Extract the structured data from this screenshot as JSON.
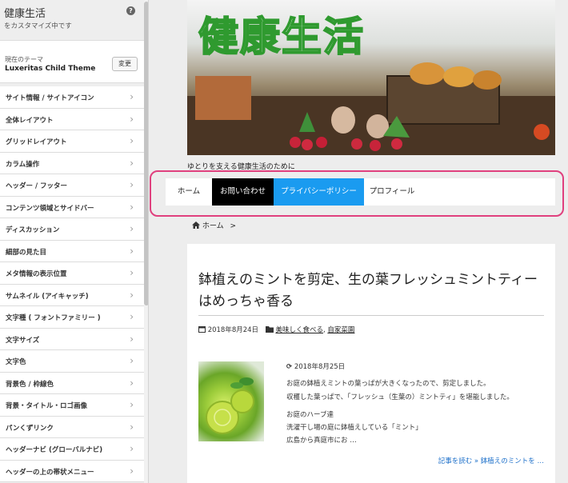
{
  "sidebar": {
    "title": "健康生活",
    "subtitle": "をカスタマイズ中です",
    "help_icon": "?",
    "theme_label": "現在のテーマ",
    "theme_name": "Luxeritas Child Theme",
    "change_label": "変更",
    "items": [
      {
        "label": "サイト情報 / サイトアイコン"
      },
      {
        "label": "全体レイアウト"
      },
      {
        "label": "グリッドレイアウト"
      },
      {
        "label": "カラム操作"
      },
      {
        "label": "ヘッダー / フッター"
      },
      {
        "label": "コンテンツ領域とサイドバー"
      },
      {
        "label": "ディスカッション"
      },
      {
        "label": "細部の見た目"
      },
      {
        "label": "メタ情報の表示位置"
      },
      {
        "label": "サムネイル (アイキャッチ)"
      },
      {
        "label": "文字種 ( フォントファミリー )"
      },
      {
        "label": "文字サイズ"
      },
      {
        "label": "文字色"
      },
      {
        "label": "背景色 / 枠線色"
      },
      {
        "label": "背景・タイトル・ロゴ画像"
      },
      {
        "label": "パンくずリンク"
      },
      {
        "label": "ヘッダーナビ (グローバルナビ)"
      },
      {
        "label": "ヘッダーの上の帯状メニュー"
      }
    ],
    "chevron": "›"
  },
  "preview": {
    "site_title": "健康生活",
    "tagline": "ゆとりを支える健康生活のために",
    "nav": [
      {
        "label": "ホーム",
        "bg": "#ffffff",
        "color": "#222222"
      },
      {
        "label": "お問い合わせ",
        "bg": "#000000",
        "color": "#ffffff"
      },
      {
        "label": "プライバシーポリシー",
        "bg": "#1a9bf0",
        "color": "#ffffff"
      },
      {
        "label": "プロフィール",
        "bg": "#ffffff",
        "color": "#222222"
      }
    ],
    "highlight_color": "#e0407e",
    "breadcrumb": {
      "home": "ホーム",
      "sep": ">"
    },
    "article": {
      "title": "鉢植えのミントを剪定、生の葉フレッシュミントティーはめっちゃ香る",
      "date": "2018年8月24日",
      "categories": [
        "美味しく食べる",
        "自家菜園"
      ],
      "category_sep": ",",
      "updated": "2018年8月25日",
      "excerpt": [
        "お庭の鉢植えミントの葉っぱが大きくなったので、剪定しました。",
        "収穫した葉っぱで、「フレッシュ（生葉の）ミントティ」を堪能しました。",
        "",
        "お庭のハーブ達",
        "洗濯干し場の庭に鉢植えしている「ミント」",
        "広島から真庭市にお …"
      ],
      "read_more": "記事を読む »  鉢植えのミントを …"
    }
  }
}
